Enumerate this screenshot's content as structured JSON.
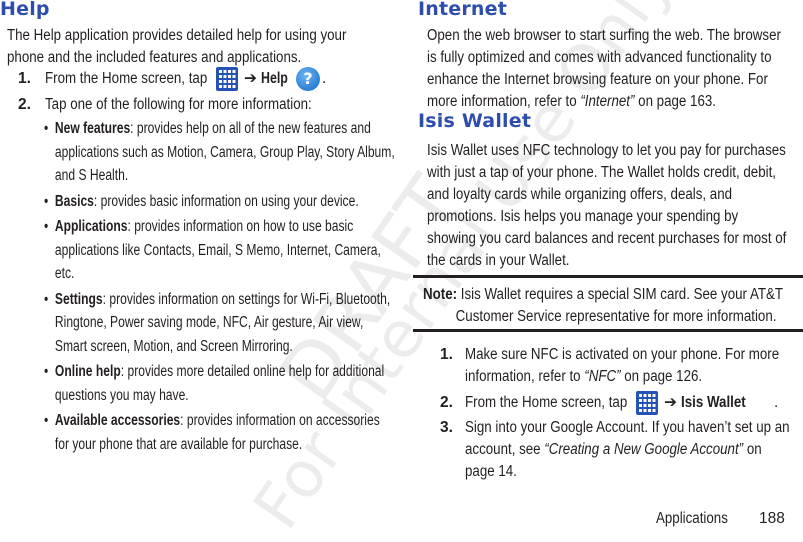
{
  "watermark": {
    "line1": "DRAFT",
    "line2": "For Internal Use Only"
  },
  "help": {
    "title": "Help",
    "intro_line1": "The Help application provides detailed help for using your",
    "intro_line2": "phone and the included features and applications.",
    "step1": {
      "num": "1.",
      "text": "From the Home screen, tap",
      "arrow": "➔",
      "target": "Help",
      "end": ".",
      "icons": [
        "apps-grid-icon",
        "help-question-icon"
      ]
    },
    "step2": {
      "num": "2.",
      "text": "Tap one of the following for more information:"
    },
    "bullets": [
      {
        "term": "New features",
        "lines": [
          ": provides help on all of the new features and",
          "applications such as Motion, Camera, Group Play, Story Album,",
          "and S Health."
        ]
      },
      {
        "term": "Basics",
        "lines": [
          ": provides basic information on using your device."
        ]
      },
      {
        "term": "Applications",
        "lines": [
          ": provides information on how to use basic",
          "applications like Contacts, Email, S Memo, Internet, Camera,",
          "etc."
        ]
      },
      {
        "term": "Settings",
        "lines": [
          ": provides information on settings for Wi-Fi, Bluetooth,",
          "Ringtone, Power saving mode, NFC, Air gesture, Air view,",
          "Smart screen, Motion, and Screen Mirroring."
        ]
      },
      {
        "term": "Online help",
        "lines": [
          ": provides more detailed online help for additional",
          "questions you may have."
        ]
      },
      {
        "term": "Available accessories",
        "lines": [
          ": provides information on accessories",
          "for your phone that are available for purchase."
        ]
      }
    ]
  },
  "internet": {
    "title": "Internet",
    "lines": [
      "Open the web browser to start surfing the web. The browser",
      "is fully optimized and comes with advanced functionality to",
      "enhance the Internet browsing feature on your phone. For"
    ],
    "ref_prefix": "more information, refer to ",
    "ref_link": "“Internet”",
    "ref_suffix": "  on page 163."
  },
  "isis": {
    "title": "Isis Wallet",
    "lines": [
      "Isis Wallet uses NFC technology to let you pay for purchases",
      "with just a tap of your phone. The Wallet holds credit, debit,",
      "and loyalty cards while organizing offers, deals, and",
      "promotions. Isis helps you manage your spending by",
      "showing you card balances and recent purchases for most of",
      "the cards in your Wallet."
    ],
    "note": {
      "label": "Note:",
      "line1": " Isis Wallet requires a special SIM card. See your AT&T",
      "line2": "Customer Service representative for more information."
    },
    "steps": [
      {
        "num": "1.",
        "line1": "Make sure NFC is activated on your phone. For more",
        "ref_prefix": "information, refer to ",
        "ref_link": "“NFC”",
        "ref_suffix": "  on page 126."
      },
      {
        "num": "2.",
        "text": "From the Home screen, tap",
        "arrow": "➔",
        "target": "Isis Wallet",
        "end": "."
      },
      {
        "num": "3.",
        "line1": "Sign into your Google Account. If you haven’t set up an",
        "ref_prefix": "account, see ",
        "ref_link": "“Creating a New Google Account”",
        "ref_suffix": " on",
        "line3": "page 14."
      }
    ]
  },
  "footer": {
    "section": "Applications",
    "page": "188"
  }
}
